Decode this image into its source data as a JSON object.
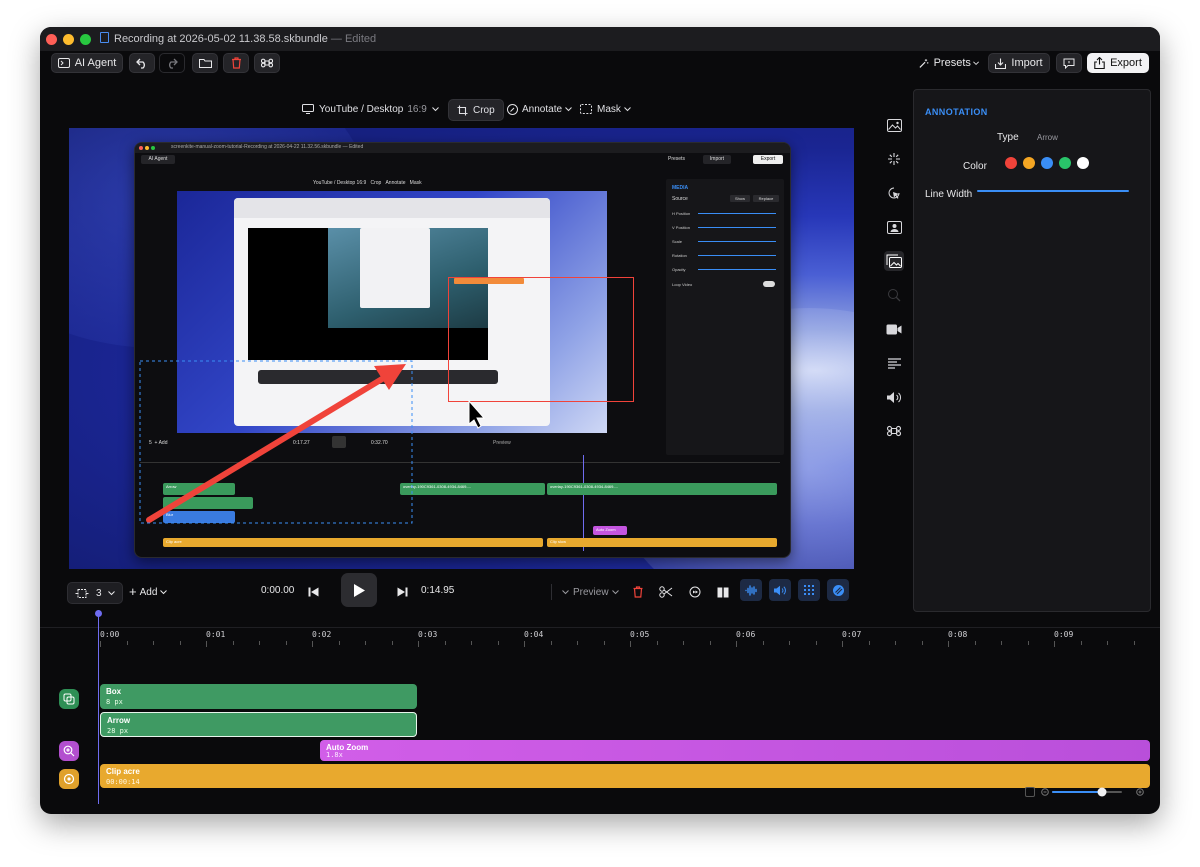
{
  "window": {
    "title": "Recording at 2026-05-02 11.38.58.skbundle",
    "title_separator": "—",
    "edited": "Edited"
  },
  "toolbar": {
    "ai_agent": "AI Agent",
    "presets": "Presets",
    "import": "Import",
    "export": "Export"
  },
  "viewbar": {
    "aspect_name": "YouTube / Desktop",
    "aspect_ratio": "16:9",
    "crop": "Crop",
    "annotate": "Annotate",
    "mask": "Mask"
  },
  "annotation_panel": {
    "title": "ANNOTATION",
    "type_label": "Type",
    "type_value": "Arrow",
    "color_label": "Color",
    "colors": [
      "#f0433a",
      "#f5a623",
      "#3a8ef6",
      "#29c46a",
      "#ffffff"
    ],
    "line_width_label": "Line Width"
  },
  "sidebar_icons": [
    "image-icon",
    "sparkle-icon",
    "cursor-click-icon",
    "person-frame-icon",
    "overlay-media-icon",
    "search-zoom-icon",
    "video-camera-icon",
    "captions-icon",
    "volume-icon",
    "command-icon"
  ],
  "controls": {
    "layers_count": "3",
    "add": "Add",
    "current_time": "0:00.00",
    "total_time": "0:14.95",
    "preview": "Preview"
  },
  "ruler": [
    "0:00",
    "0:01",
    "0:02",
    "0:03",
    "0:04",
    "0:05",
    "0:06",
    "0:07",
    "0:08",
    "0:09"
  ],
  "clips": {
    "box": {
      "name": "Box",
      "detail": "8 px"
    },
    "arrow": {
      "name": "Arrow",
      "detail": "28 px"
    },
    "auto_zoom": {
      "name": "Auto Zoom",
      "detail": "1.8x"
    },
    "clip": {
      "name": "Clip acre",
      "detail": "00:00:14"
    }
  },
  "inner_screenshot": {
    "title": "screenkite-manual-zoom-tutorial-Recording at 2026-04-22 11.32.56.skbundle",
    "edited": "Edited",
    "ai_agent": "AI Agent",
    "presets": "Presets",
    "import": "Import",
    "export": "Export",
    "aspect": "YouTube / Desktop 16:9",
    "crop": "Crop",
    "annotate": "Annotate",
    "mask": "Mask",
    "media_title": "MEDIA",
    "source": "Source",
    "show": "Show",
    "replace": "Replace",
    "h_position": "H Position",
    "v_position": "V Position",
    "scale": "Scale",
    "rotation": "Rotation",
    "opacity": "Opacity",
    "loop_video": "Loop Video",
    "layers_count": "5",
    "add": "Add",
    "current_time": "0:17.27",
    "total_time": "0:32.70",
    "preview": "Preview",
    "clip_arrow": "Arrow",
    "clip_blur": "Blur",
    "clip_overlay_a": "overlay-190C9361-0308-4934-8469-...",
    "clip_overlay_b": "overlay-190C9361-0308-4934-8469-...",
    "clip_auto_zoom": "Auto Zoom",
    "clip_acre": "Clip acre",
    "clip_slow": "Clip slow"
  }
}
